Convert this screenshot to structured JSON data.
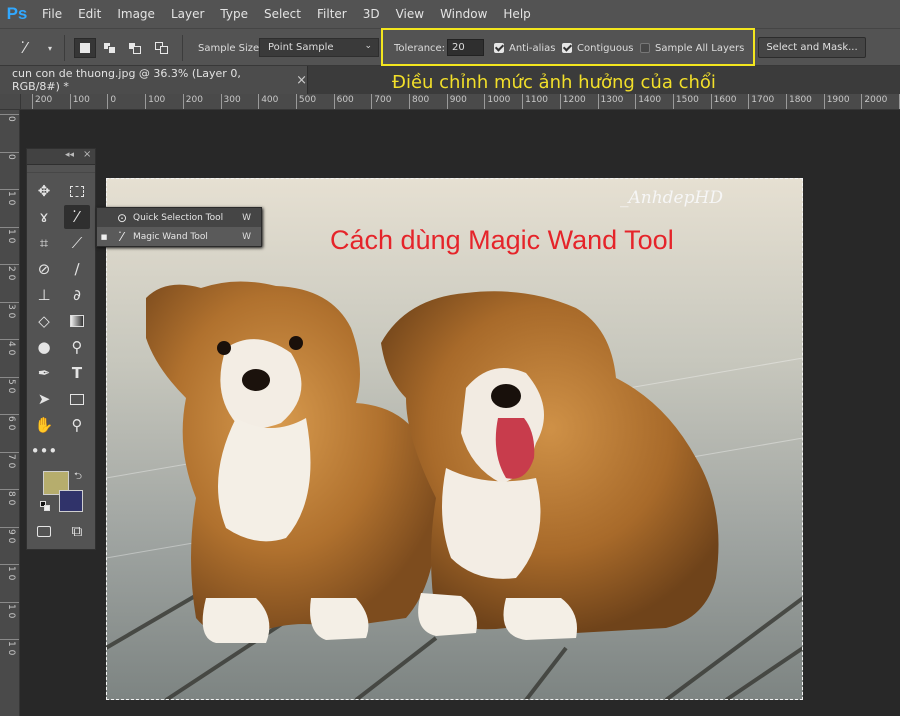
{
  "app": {
    "logo": "Ps"
  },
  "menu": [
    "File",
    "Edit",
    "Image",
    "Layer",
    "Type",
    "Select",
    "Filter",
    "3D",
    "View",
    "Window",
    "Help"
  ],
  "options": {
    "sample_size_label": "Sample Size:",
    "sample_size_value": "Point Sample",
    "tolerance_label": "Tolerance:",
    "tolerance_value": "20",
    "anti_alias": "Anti-alias",
    "contiguous": "Contiguous",
    "sample_all_layers": "Sample All Layers",
    "select_mask": "Select and Mask..."
  },
  "document": {
    "tab_title": "cun con de thuong.jpg @ 36.3% (Layer 0, RGB/8#) *"
  },
  "annotation": "Điều chỉnh mức ảnh hưởng của chổi",
  "ruler": {
    "h": [
      "200",
      "100",
      "0",
      "100",
      "200",
      "300",
      "400",
      "500",
      "600",
      "700",
      "800",
      "900",
      "1000",
      "1100",
      "1200",
      "1300",
      "1400",
      "1500",
      "1600",
      "1700",
      "1800",
      "1900",
      "2000",
      "2100"
    ],
    "v": [
      "0",
      "0",
      "1 0",
      "1 0",
      "2 0",
      "3 0",
      "4 0",
      "5 0",
      "6 0",
      "7 0",
      "8 0",
      "9 0",
      "1 0",
      "1 0",
      "1 0"
    ]
  },
  "photo": {
    "watermark": "_AnhdepHD",
    "caption": "Cách dùng Magic Wand Tool"
  },
  "tools_panel": {
    "collapse": "◂◂",
    "close": "×"
  },
  "flyout": [
    {
      "label": "Quick Selection Tool",
      "shortcut": "W"
    },
    {
      "label": "Magic Wand Tool",
      "shortcut": "W"
    }
  ]
}
